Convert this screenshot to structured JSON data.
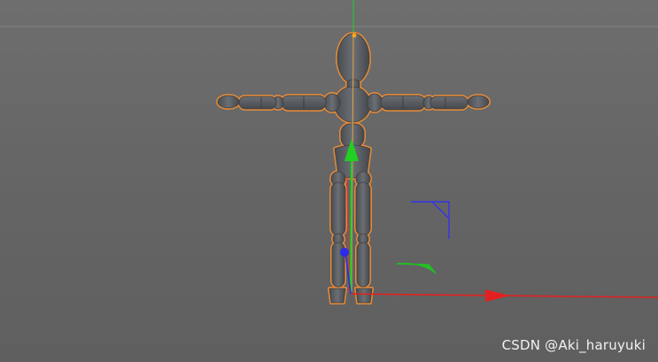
{
  "viewport": {
    "background": "#656565",
    "horizon_color": "#7a7a7a",
    "selection_outline_color": "#e08a3c",
    "figure_color": "#5a5d62"
  },
  "gizmo": {
    "x_axis_color": "#e32020",
    "y_axis_color": "#22d022",
    "z_axis_color": "#2a2ae8"
  },
  "watermark": {
    "text": "CSDN @Aki_haruyuki"
  }
}
